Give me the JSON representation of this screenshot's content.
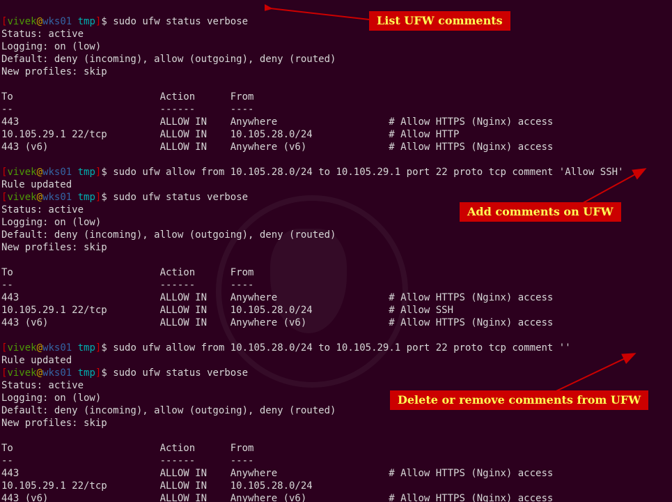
{
  "prompt": {
    "open": "[",
    "user": "vivek",
    "at": "@",
    "host": "wks01",
    "cwd": " tmp",
    "close": "]",
    "dollar": "$ "
  },
  "block1": {
    "cmd": "sudo ufw status verbose",
    "status": "Status: active",
    "logging": "Logging: on (low)",
    "default": "Default: deny (incoming), allow (outgoing), deny (routed)",
    "profiles": "New profiles: skip",
    "header": "To                         Action      From",
    "headerul": "--                         ------      ----",
    "r1": "443                        ALLOW IN    Anywhere                   # Allow HTTPS (Nginx) access",
    "r2": "10.105.29.1 22/tcp         ALLOW IN    10.105.28.0/24             # Allow HTTP",
    "r3": "443 (v6)                   ALLOW IN    Anywhere (v6)              # Allow HTTPS (Nginx) access"
  },
  "block2": {
    "cmd1": "sudo ufw allow from 10.105.28.0/24 to 10.105.29.1 port 22 proto tcp comment 'Allow SSH'",
    "ruleupdated": "Rule updated",
    "cmd2": "sudo ufw status verbose",
    "status": "Status: active",
    "logging": "Logging: on (low)",
    "default": "Default: deny (incoming), allow (outgoing), deny (routed)",
    "profiles": "New profiles: skip",
    "header": "To                         Action      From",
    "headerul": "--                         ------      ----",
    "r1": "443                        ALLOW IN    Anywhere                   # Allow HTTPS (Nginx) access",
    "r2": "10.105.29.1 22/tcp         ALLOW IN    10.105.28.0/24             # Allow SSH",
    "r3": "443 (v6)                   ALLOW IN    Anywhere (v6)              # Allow HTTPS (Nginx) access"
  },
  "block3": {
    "cmd1": "sudo ufw allow from 10.105.28.0/24 to 10.105.29.1 port 22 proto tcp comment ''",
    "ruleupdated": "Rule updated",
    "cmd2": "sudo ufw status verbose",
    "status": "Status: active",
    "logging": "Logging: on (low)",
    "default": "Default: deny (incoming), allow (outgoing), deny (routed)",
    "profiles": "New profiles: skip",
    "header": "To                         Action      From",
    "headerul": "--                         ------      ----",
    "r1": "443                        ALLOW IN    Anywhere                   # Allow HTTPS (Nginx) access",
    "r2": "10.105.29.1 22/tcp         ALLOW IN    10.105.28.0/24",
    "r3": "443 (v6)                   ALLOW IN    Anywhere (v6)              # Allow HTTPS (Nginx) access"
  },
  "annotations": {
    "a1": "List UFW comments",
    "a2": "Add comments on UFW",
    "a3": "Delete or remove comments from UFW"
  }
}
